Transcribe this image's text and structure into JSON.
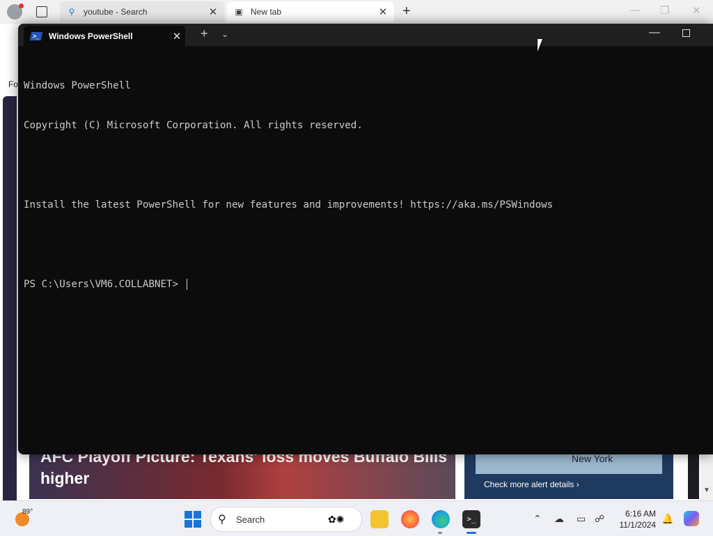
{
  "browser": {
    "tabs": [
      {
        "label": "youtube - Search",
        "icon": "search-icon"
      },
      {
        "label": "New tab",
        "icon": "newtab-icon"
      }
    ],
    "page_partial_text": "Fo",
    "news_headline": "AFC Playoff Picture: Texans' loss moves Buffalo Bills higher",
    "alert_map_label": "New York",
    "alert_link": "Check more alert details"
  },
  "terminal": {
    "tab_title": "Windows PowerShell",
    "lines": [
      "Windows PowerShell",
      "Copyright (C) Microsoft Corporation. All rights reserved.",
      "",
      "Install the latest PowerShell for new features and improvements! https://aka.ms/PSWindows",
      "",
      "PS C:\\Users\\VM6.COLLABNET> "
    ]
  },
  "taskbar": {
    "weather_temp": "89°",
    "search_placeholder": "Search",
    "time": "6:16 AM",
    "date": "11/1/2024"
  },
  "colors": {
    "terminal_bg": "#0c0c0c",
    "terminal_text": "#cccccc",
    "accent": "#1a74d8"
  }
}
